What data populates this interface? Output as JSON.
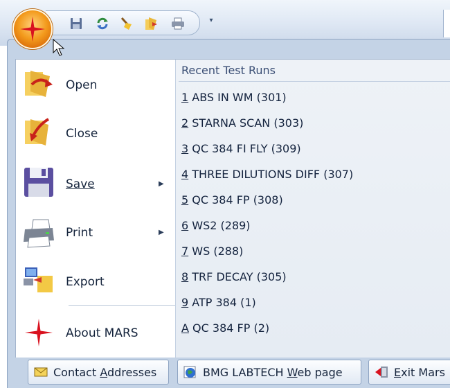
{
  "quick_access": {
    "icons": [
      "save-icon",
      "refresh-icon",
      "clean-icon",
      "open-folder-icon",
      "print-icon"
    ],
    "more": "▾"
  },
  "menu": {
    "items": [
      {
        "label": "Open",
        "icon": "open-folder-icon",
        "has_submenu": false
      },
      {
        "label": "Close",
        "icon": "close-folder-icon",
        "has_submenu": false
      },
      {
        "label": "Save",
        "icon": "floppy-icon",
        "has_submenu": true
      },
      {
        "label": "Print",
        "icon": "printer-icon",
        "has_submenu": true
      },
      {
        "label": "Export",
        "icon": "export-icon",
        "has_submenu": false
      },
      {
        "label": "About MARS",
        "icon": "star-icon",
        "has_submenu": false
      }
    ],
    "submenu_arrow": "▶"
  },
  "recent": {
    "header": "Recent Test Runs",
    "runs": [
      {
        "key": "1",
        "text": " ABS IN WM (301)"
      },
      {
        "key": "2",
        "text": " STARNA SCAN (303)"
      },
      {
        "key": "3",
        "text": " QC 384 FI FLY (309)"
      },
      {
        "key": "4",
        "text": " THREE DILUTIONS DIFF (307)"
      },
      {
        "key": "5",
        "text": " QC 384 FP (308)"
      },
      {
        "key": "6",
        "text": " WS2 (289)"
      },
      {
        "key": "7",
        "text": " WS (288)"
      },
      {
        "key": "8",
        "text": " TRF DECAY (305)"
      },
      {
        "key": "9",
        "text": " ATP 384 (1)"
      },
      {
        "key": "A",
        "text": " QC 384 FP (2)"
      }
    ]
  },
  "footer": {
    "contact": {
      "pre": "Contact ",
      "acc": "A",
      "post": "ddresses"
    },
    "web": {
      "pre": "BMG LABTECH ",
      "acc": "W",
      "post": "eb page"
    },
    "exit": {
      "pre": "",
      "acc": "E",
      "post": "xit Mars"
    }
  },
  "colors": {
    "orb": "#f39a1c",
    "accent_red": "#d9121f",
    "frame": "#c4d3e6"
  }
}
